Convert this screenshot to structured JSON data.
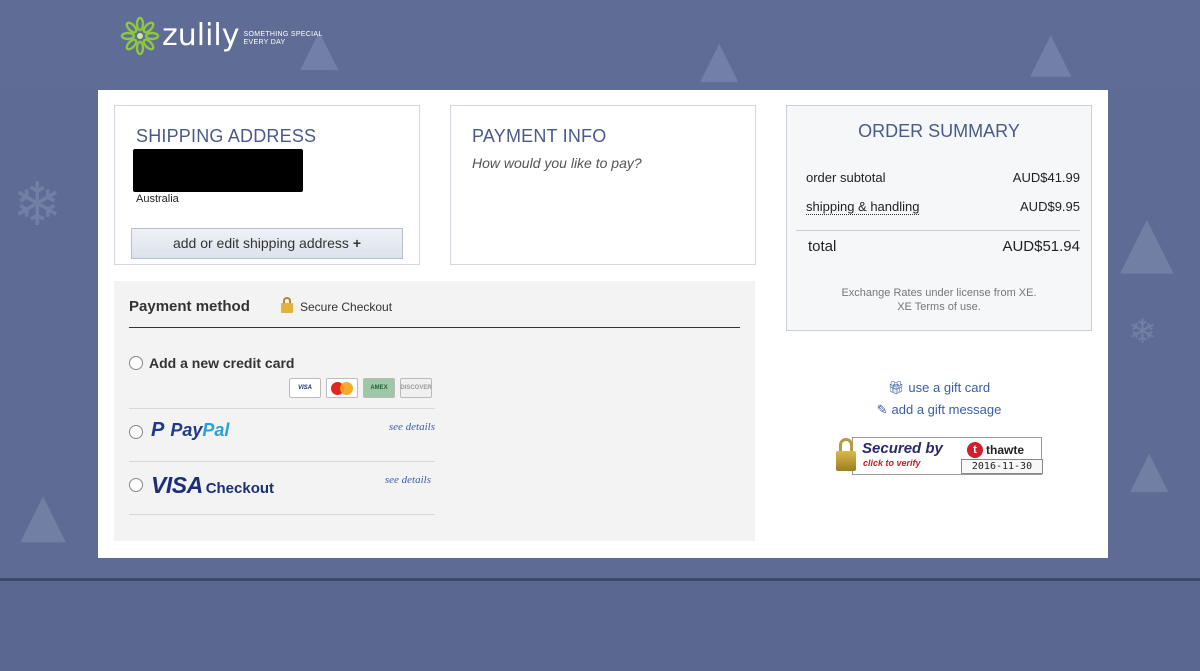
{
  "header": {
    "logo_word": "zulily",
    "tagline_line1": "SOMETHING SPECIAL",
    "tagline_line2": "EVERY DAY"
  },
  "shipping": {
    "title": "SHIPPING ADDRESS",
    "country": "Australia",
    "edit_button_label": "add or edit shipping address",
    "edit_button_icon": "+"
  },
  "payment_info": {
    "title": "PAYMENT INFO",
    "question": "How would you like to pay?"
  },
  "payment_method": {
    "title": "Payment method",
    "secure_label": "Secure Checkout",
    "options": [
      {
        "label": "Add a new credit card",
        "cards": [
          "VISA",
          "MasterCard",
          "AMEX",
          "DISCOVER"
        ]
      },
      {
        "label": "PayPal",
        "logo_part1": "Pay",
        "logo_part2": "Pal",
        "details": "see details"
      },
      {
        "label": "VISA Checkout",
        "logo_part1": "VISA",
        "logo_part2": "Checkout",
        "details": "see details"
      }
    ]
  },
  "order_summary": {
    "title": "ORDER SUMMARY",
    "subtotal_label": "order subtotal",
    "subtotal_value": "AUD$41.99",
    "shipping_label": "shipping & handling",
    "shipping_value": "AUD$9.95",
    "total_label": "total",
    "total_value": "AUD$51.94",
    "xe_line1": "Exchange Rates under license from XE.",
    "xe_line2": "XE Terms of use."
  },
  "gift": {
    "gift_card": "use a gift card",
    "gift_message": "add a gift message"
  },
  "seal": {
    "secured_by": "Secured by",
    "brand": "thawte",
    "brand_initial": "t",
    "click_to_verify": "click to verify",
    "date": "2016-11-30"
  },
  "colors": {
    "background": "#5e6b94",
    "title_blue": "#4a5a8a",
    "link_blue": "#3a5ea8",
    "logo_green": "#8dc63f"
  },
  "icons": [
    "zulily-flower-logo",
    "lock-icon",
    "plus-icon",
    "gift-icon",
    "edit-icon",
    "padlock-icon"
  ]
}
